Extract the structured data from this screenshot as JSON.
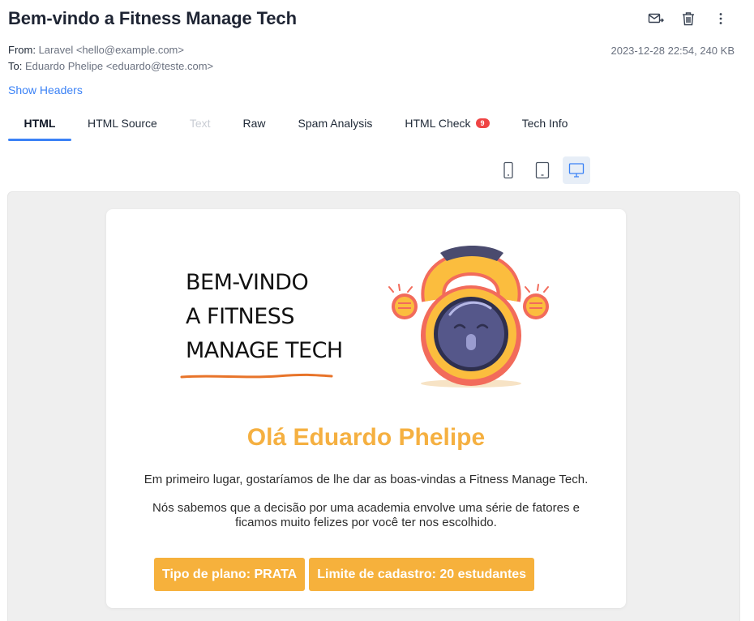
{
  "email": {
    "subject": "Bem-vindo a Fitness Manage Tech",
    "from_label": "From:",
    "from_value": "Laravel <hello@example.com>",
    "to_label": "To:",
    "to_value": "Eduardo Phelipe <eduardo@teste.com>",
    "date_size": "2023-12-28 22:54, 240 KB",
    "show_headers": "Show Headers"
  },
  "actions": {
    "icons": [
      "forward-mail-icon",
      "trash-icon",
      "more-vertical-icon"
    ]
  },
  "tabs": [
    {
      "label": "HTML",
      "active": true
    },
    {
      "label": "HTML Source"
    },
    {
      "label": "Text",
      "disabled": true
    },
    {
      "label": "Raw"
    },
    {
      "label": "Spam Analysis"
    },
    {
      "label": "HTML Check",
      "badge": "9"
    },
    {
      "label": "Tech Info"
    }
  ],
  "devices": {
    "icons": [
      "phone-icon",
      "tablet-icon",
      "desktop-icon"
    ],
    "active": "desktop-icon"
  },
  "message": {
    "hero_lines": [
      "BEM-VINDO",
      "A FITNESS",
      "MANAGE TECH"
    ],
    "greeting": "Olá Eduardo Phelipe",
    "paragraph1": "Em primeiro lugar, gostaríamos de lhe dar as boas-vindas a Fitness Manage Tech.",
    "paragraph2_line1": "Nós sabemos que a decisão por uma academia envolve uma série de fatores e",
    "paragraph2_line2": "ficamos muito felizes por você ter nos escolhido.",
    "plan_label": "Tipo de plano: PRATA",
    "limit_label": "Limite de cadastro: 20 estudantes"
  },
  "colors": {
    "accent_blue": "#3b82f6",
    "greeting_orange": "#f5b041",
    "plan_button": "#f6b13c",
    "badge_red": "#ef4444",
    "underline_orange": "#e8742a"
  }
}
